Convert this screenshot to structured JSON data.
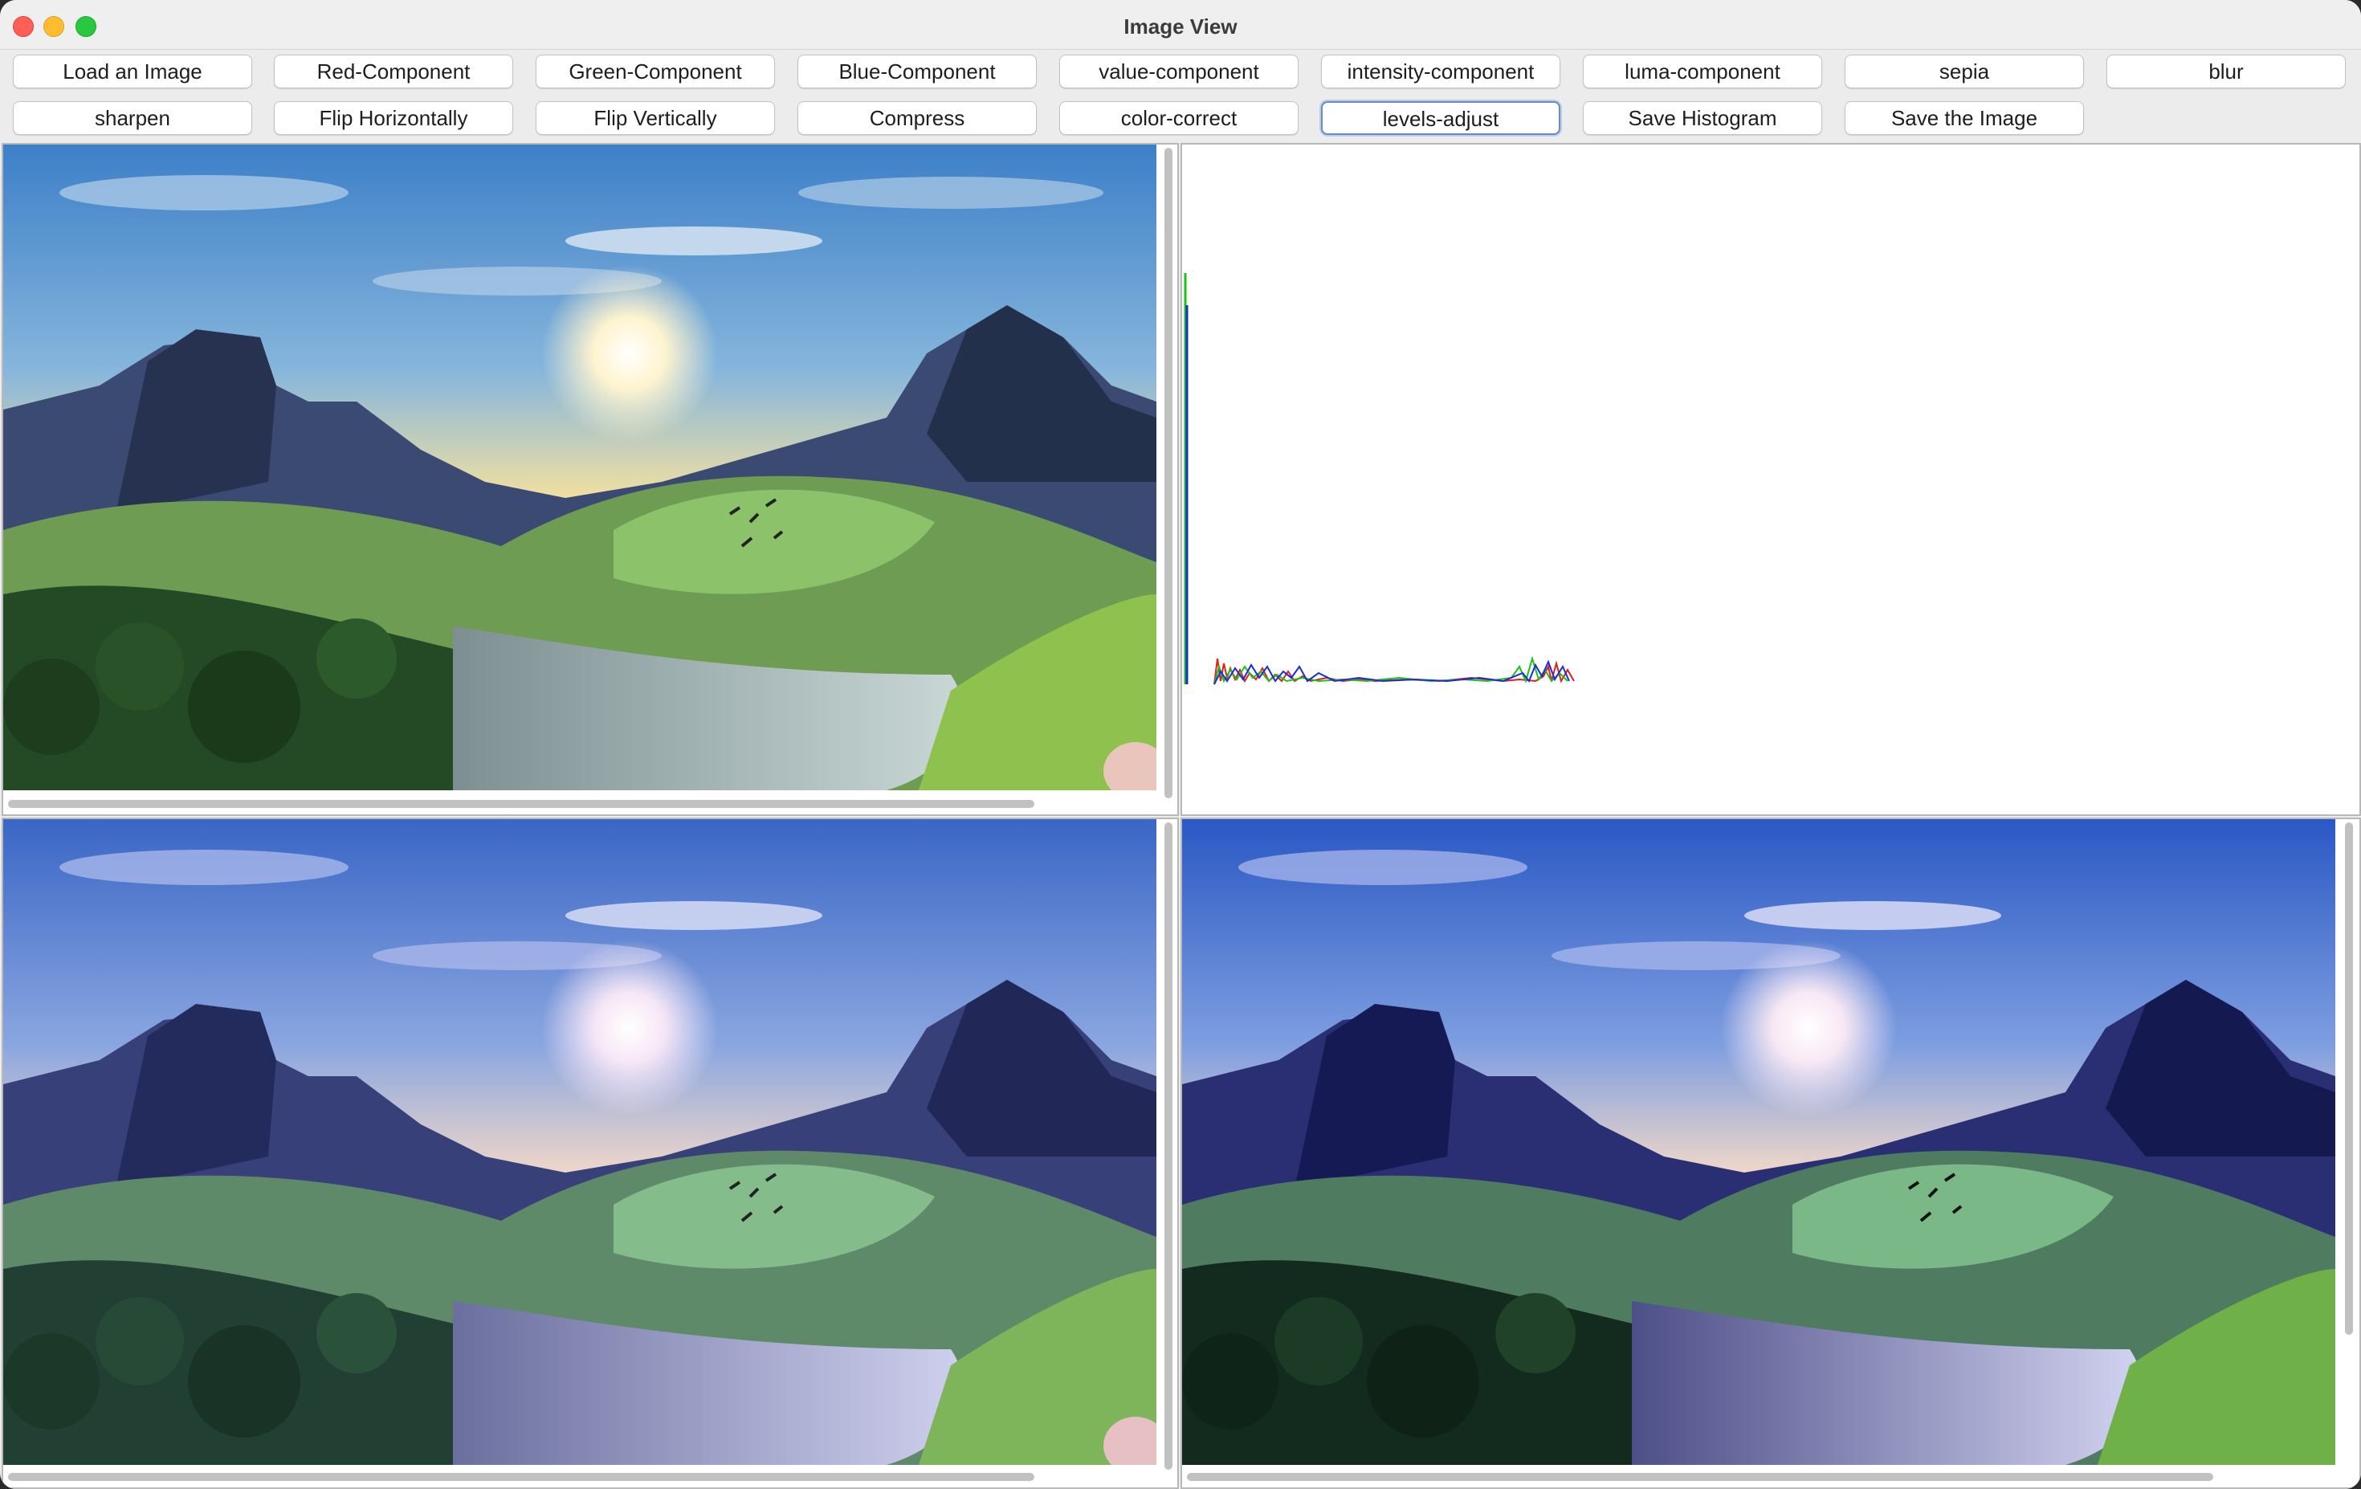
{
  "window": {
    "title": "Image View"
  },
  "toolbar": {
    "row1": [
      "Load an Image",
      "Red-Component",
      "Green-Component",
      "Blue-Component",
      "value-component",
      "intensity-component",
      "luma-component",
      "sepia",
      "blur"
    ],
    "row2": [
      "sharpen",
      "Flip Horizontally",
      "Flip Vertically",
      "Compress",
      "color-correct",
      "levels-adjust",
      "Save Histogram",
      "Save the Image"
    ],
    "focused": "levels-adjust"
  },
  "panels": {
    "original": "landscape-image",
    "histogram": "rgb-histogram",
    "preview": "landscape-image-blue-tint",
    "result": "landscape-image-levels-adjusted"
  },
  "histogram_colors": {
    "red": "#e0201c",
    "green": "#19c419",
    "blue": "#1c2bd6"
  },
  "icons": [
    "close-icon",
    "minimize-icon",
    "zoom-icon"
  ]
}
